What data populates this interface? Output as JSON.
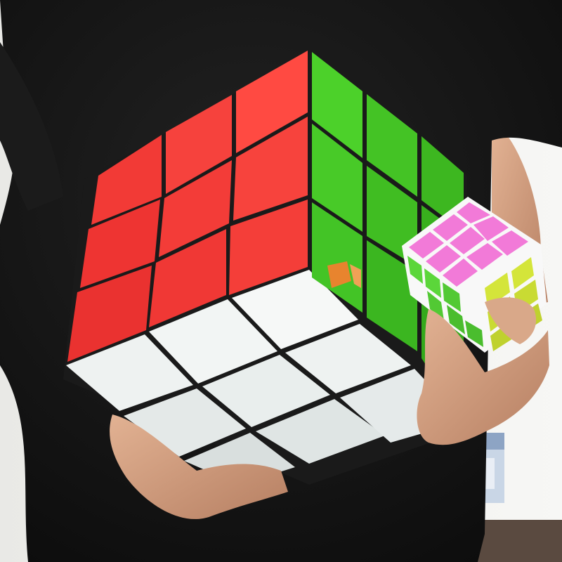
{
  "scene": {
    "subject": "giant-3x3-puzzle-cube-and-standard-cube",
    "colors": {
      "background": "#f2f2ef",
      "shirt": "#141414",
      "skin": "#d9a889",
      "skin_shadow": "#a9735a",
      "big_cube_red": "#f23a36",
      "big_cube_red_light": "#ff6b60",
      "big_cube_green": "#4cd12a",
      "big_cube_green_dark": "#2f9c17",
      "big_cube_white": "#eef2f1",
      "big_cube_white_shadow": "#c9d1d0",
      "small_cube_pink": "#f27ad8",
      "small_cube_yellow": "#d4e53a",
      "small_cube_green": "#5bd63a",
      "small_cube_body": "#f8f8f8",
      "logo_orange": "#e8842e"
    },
    "icons": [
      "big-cube-icon",
      "small-cube-icon",
      "logo-emblem-icon",
      "product-box-icon"
    ]
  }
}
